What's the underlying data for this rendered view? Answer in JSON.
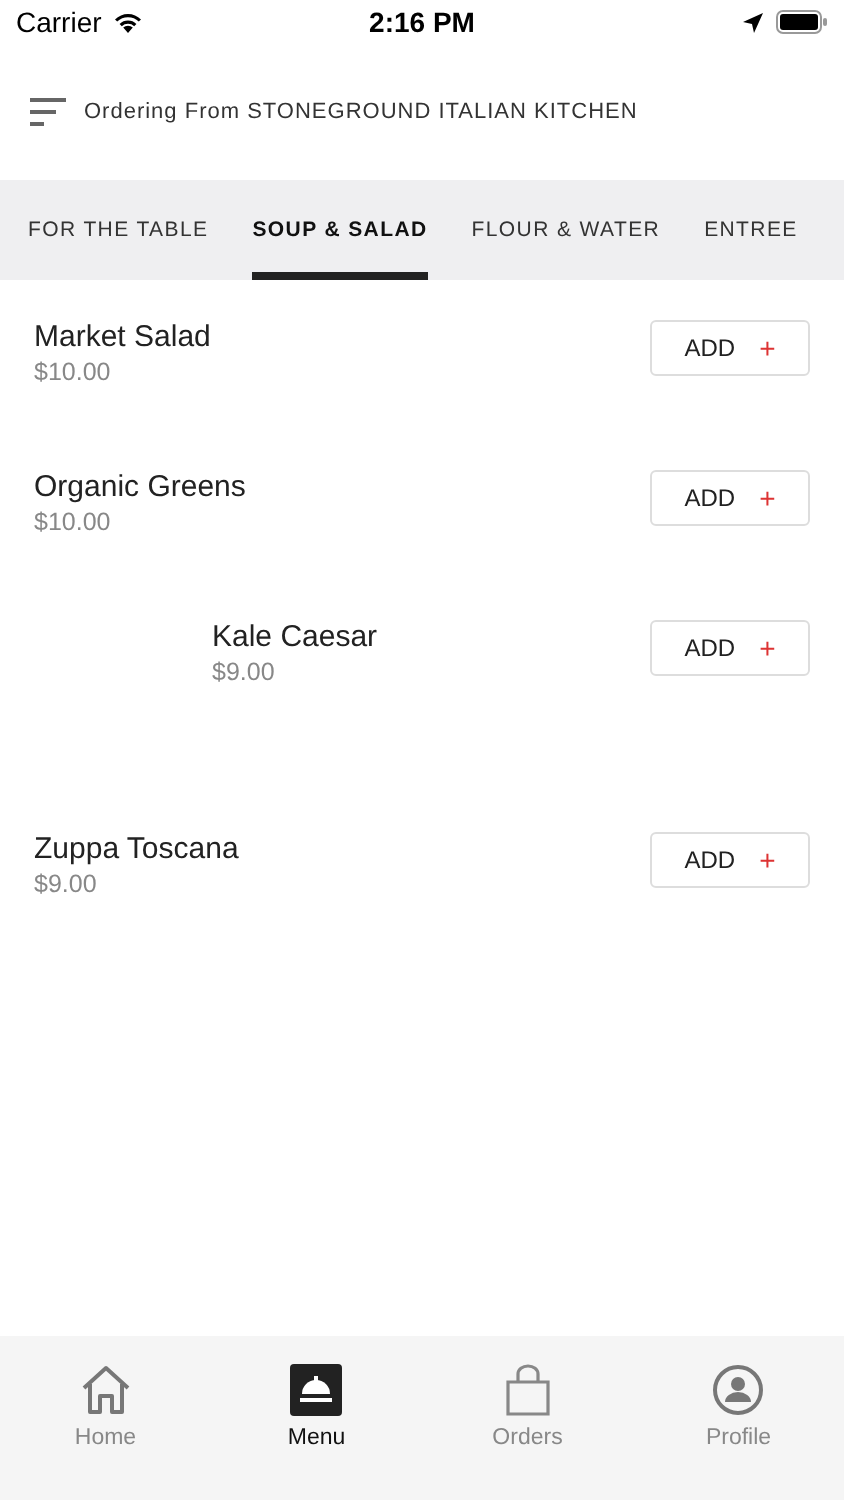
{
  "status_bar": {
    "carrier": "Carrier",
    "time": "2:16 PM"
  },
  "header": {
    "title": "Ordering From STONEGROUND ITALIAN KITCHEN"
  },
  "tabs": [
    {
      "label": "FOR THE TABLE",
      "selected": false
    },
    {
      "label": "SOUP & SALAD",
      "selected": true
    },
    {
      "label": "FLOUR & WATER",
      "selected": false
    },
    {
      "label": "ENTREE",
      "selected": false
    }
  ],
  "items": [
    {
      "kind": "plain",
      "name": "Market Salad",
      "price": "$10.00",
      "button": "ADD",
      "button_icon": "+"
    },
    {
      "kind": "plain",
      "name": "Organic Greens",
      "price": "$10.00",
      "button": "ADD",
      "button_icon": "+"
    },
    {
      "kind": "indented",
      "name": "Kale Caesar",
      "price": "$9.00",
      "button": "ADD",
      "button_icon": "+"
    },
    {
      "kind": "plain",
      "name": "Zuppa Toscana",
      "price": "$9.00",
      "button": "ADD",
      "button_icon": "+"
    }
  ],
  "nav": [
    {
      "kind": "home",
      "label": "Home",
      "selected": false
    },
    {
      "kind": "menu",
      "label": "Menu",
      "selected": true
    },
    {
      "kind": "orders",
      "label": "Orders",
      "selected": false
    },
    {
      "kind": "profile",
      "label": "Profile",
      "selected": false
    }
  ]
}
